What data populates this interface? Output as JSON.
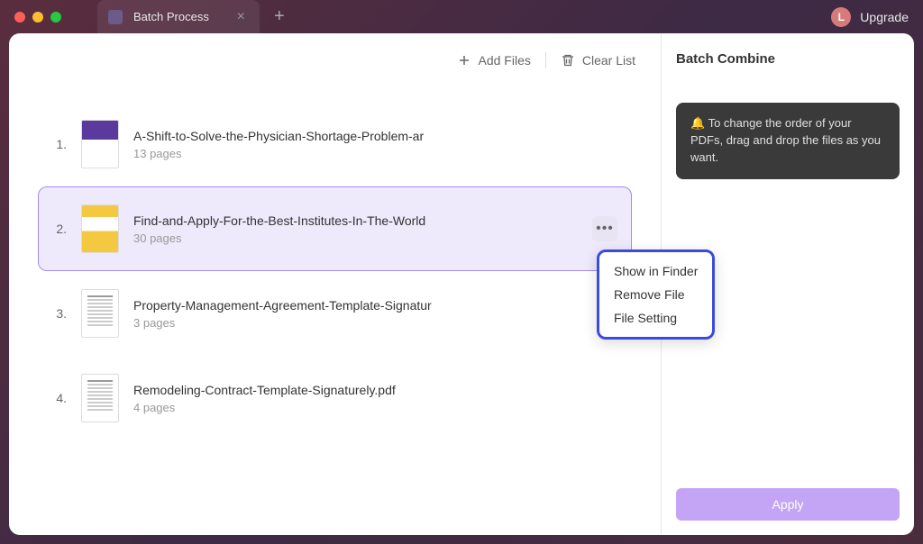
{
  "window": {
    "tab_title": "Batch Process",
    "upgrade_label": "Upgrade",
    "avatar_initial": "L"
  },
  "toolbar": {
    "add_files_label": "Add Files",
    "clear_list_label": "Clear List"
  },
  "files": [
    {
      "num": "1.",
      "name": "A-Shift-to-Solve-the-Physician-Shortage-Problem-ar",
      "pages": "13 pages"
    },
    {
      "num": "2.",
      "name": "Find-and-Apply-For-the-Best-Institutes-In-The-World",
      "pages": "30 pages"
    },
    {
      "num": "3.",
      "name": "Property-Management-Agreement-Template-Signatur",
      "pages": "3 pages"
    },
    {
      "num": "4.",
      "name": "Remodeling-Contract-Template-Signaturely.pdf",
      "pages": "4 pages"
    }
  ],
  "context_menu": {
    "show_in_finder": "Show in Finder",
    "remove_file": "Remove File",
    "file_setting": "File Setting"
  },
  "sidebar": {
    "title": "Batch Combine",
    "tip": "🔔 To change the order of your PDFs, drag and drop the files as you want.",
    "apply_label": "Apply"
  }
}
